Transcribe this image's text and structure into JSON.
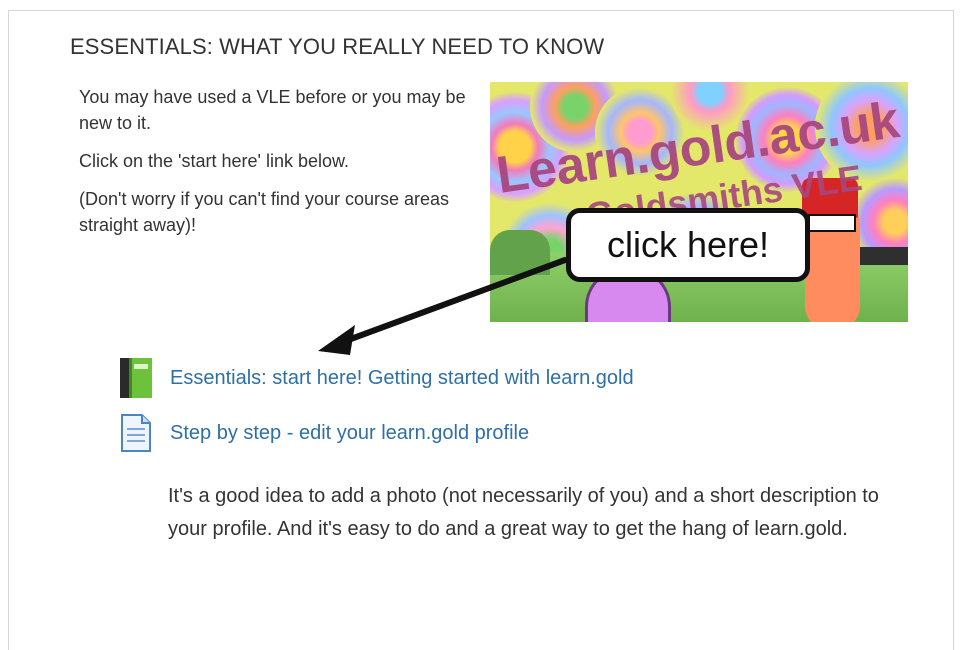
{
  "section": {
    "title": "ESSENTIALS: WHAT YOU REALLY NEED TO KNOW"
  },
  "intro": {
    "p1": "You may have used a VLE before or you may be new to it.",
    "p2": "Click on the 'start here' link below.",
    "p3": "(Don't worry if you can't find your course areas straight away)!"
  },
  "banner": {
    "line1": "Learn.gold.ac.uk",
    "line2": "Goldsmiths VLE",
    "callout": "click here!"
  },
  "links": [
    {
      "label": "Essentials: start here! Getting started with learn.gold",
      "icon": "book-icon"
    },
    {
      "label": "Step by step - edit your learn.gold profile",
      "icon": "document-icon"
    }
  ],
  "note": "It's a good idea to add a photo (not necessarily of you) and a short description to your profile. And it's easy to do and a great way to get the hang of learn.gold.",
  "colors": {
    "link": "#2f6fa6",
    "banner_bg": "#e4e86a",
    "banner_text": "#a8477f"
  }
}
